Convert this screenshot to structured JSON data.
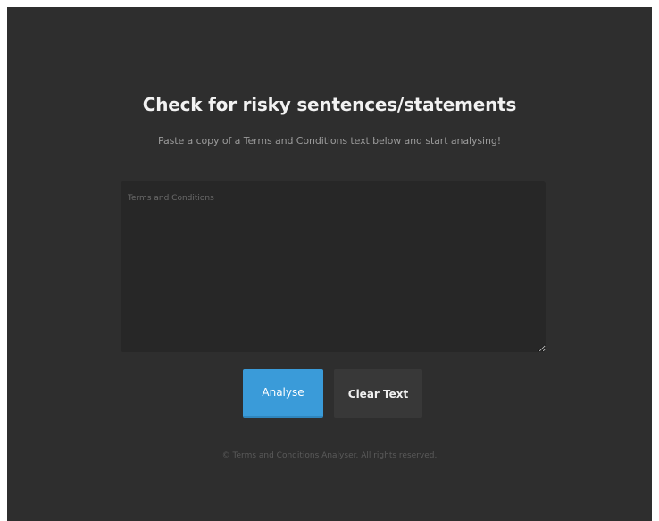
{
  "page": {
    "title": "Check for risky sentences/statements",
    "subtitle": "Paste a copy of a Terms and Conditions text below and start analysing!"
  },
  "form": {
    "textarea": {
      "placeholder": "Terms and Conditions",
      "value": ""
    },
    "analyse_label": "Analyse",
    "clear_label": "Clear Text"
  },
  "footer": {
    "copyright": "© Terms and Conditions Analyser. All rights reserved."
  },
  "colors": {
    "background": "#2e2e2e",
    "textarea_background": "#272727",
    "accent": "#3a9bd9",
    "secondary_button": "#383838"
  }
}
